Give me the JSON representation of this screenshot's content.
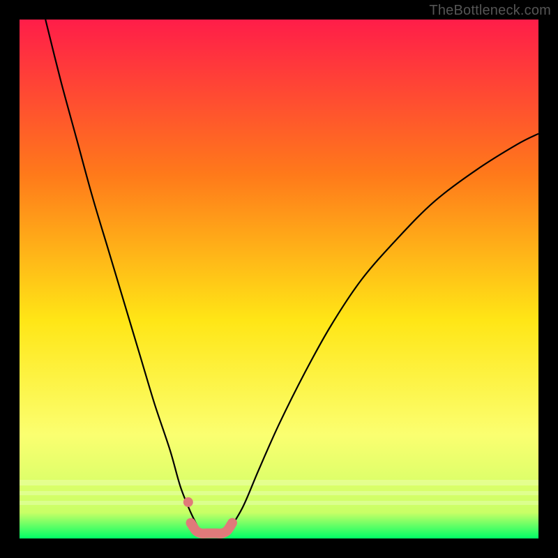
{
  "watermark": "TheBottleneck.com",
  "colors": {
    "frame": "#000000",
    "watermark": "#555555",
    "gradient_top": "#ff1d49",
    "gradient_mid_upper": "#ff7a1a",
    "gradient_mid": "#ffe616",
    "gradient_lower": "#fbff70",
    "gradient_bottom": "#00ff66",
    "curve": "#000000",
    "salmon": "#e07a7a"
  },
  "chart_data": {
    "type": "line",
    "title": "",
    "xlabel": "",
    "ylabel": "",
    "xlim": [
      0,
      100
    ],
    "ylim": [
      0,
      100
    ],
    "series": [
      {
        "name": "left-curve",
        "x": [
          5,
          8,
          11,
          14,
          17,
          20,
          23,
          26,
          29,
          31,
          33,
          35
        ],
        "values": [
          100,
          88,
          77,
          66,
          56,
          46,
          36,
          26,
          17,
          10,
          5,
          1
        ]
      },
      {
        "name": "right-curve",
        "x": [
          40,
          43,
          46,
          50,
          55,
          60,
          66,
          73,
          80,
          88,
          96,
          100
        ],
        "values": [
          1,
          6,
          13,
          22,
          32,
          41,
          50,
          58,
          65,
          71,
          76,
          78
        ]
      },
      {
        "name": "salmon-band",
        "x": [
          33,
          34,
          35,
          36,
          37,
          38,
          39,
          40,
          41
        ],
        "values": [
          3,
          1.5,
          1,
          1,
          1,
          1,
          1,
          1.5,
          3
        ]
      }
    ],
    "annotations": {
      "salmon_dot": {
        "x": 32.5,
        "y": 7
      }
    }
  }
}
